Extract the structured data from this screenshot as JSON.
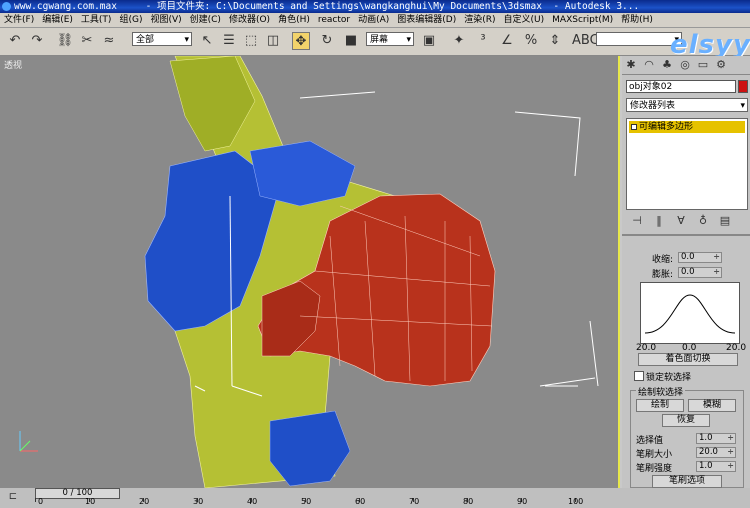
{
  "title_bar": {
    "site": "www.cgwang.com.max",
    "project": "- 项目文件夹: C:\\Documents and Settings\\wangkanghui\\My Documents\\3dsmax",
    "app": "- Autodesk 3..."
  },
  "menu": [
    "文件(F)",
    "编辑(E)",
    "工具(T)",
    "组(G)",
    "视图(V)",
    "创建(C)",
    "修改器(O)",
    "角色(H)",
    "reactor",
    "动画(A)",
    "图表编辑器(D)",
    "渲染(R)",
    "自定义(U)",
    "MAXScript(M)",
    "帮助(H)"
  ],
  "toolbar": {
    "selection_filter": "全部",
    "reference_coord": "屏幕"
  },
  "logo": "elsyy",
  "viewport": {
    "label": "透视"
  },
  "panel": {
    "object_name": "obj对象02",
    "object_color": "#cc1111",
    "modifier_list": "修改器列表",
    "stack_item": "可编辑多边形",
    "shrink_label": "收缩:",
    "shrink_value": "0.0",
    "pinch_label": "膨胀:",
    "pinch_value": "0.0",
    "curve_min": "20.0",
    "curve_mid": "0.0",
    "curve_max": "20.0",
    "color_by_face_button": "着色面切换",
    "lock_soft_sel": "锁定软选择",
    "paint_group": "绘制软选择",
    "paint_button": "绘制",
    "blur_button": "模糊",
    "revert_button": "恢复",
    "select_value_label": "选择值",
    "select_value": "1.0",
    "brush_size_label": "笔刷大小",
    "brush_size": "20.0",
    "brush_strength_label": "笔刷强度",
    "brush_strength": "1.0",
    "brush_options_button": "笔刷选项"
  },
  "timeline": {
    "slider_text": "0 / 100",
    "ticks": [
      "0",
      "10",
      "20",
      "30",
      "40",
      "50",
      "60",
      "70",
      "80",
      "90",
      "100"
    ]
  }
}
